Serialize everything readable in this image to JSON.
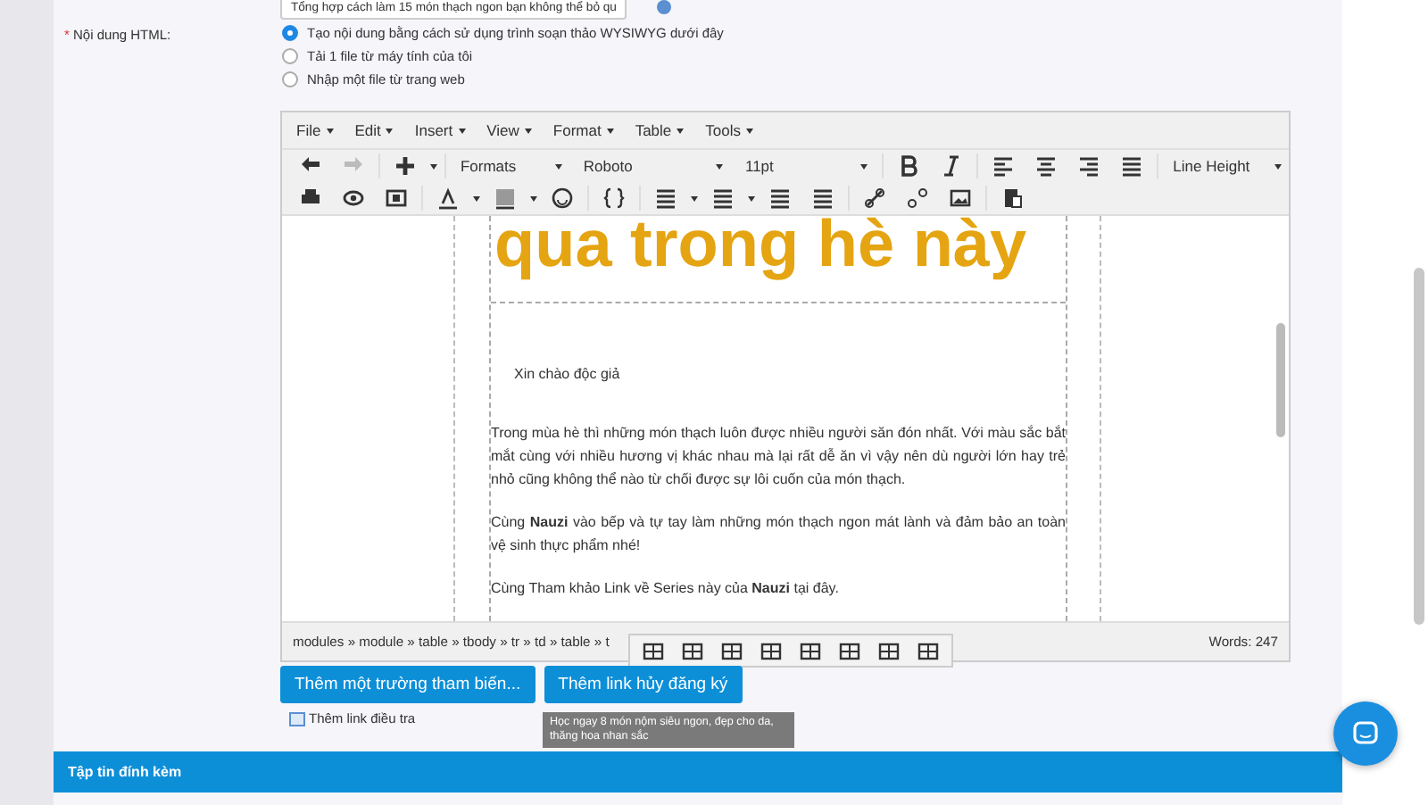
{
  "title_field": {
    "value": "Tổng hợp cách làm 15 món thạch ngon bạn không thể bỏ qu"
  },
  "html_content": {
    "label": "Nội dung HTML:",
    "required_mark": "*",
    "options": [
      {
        "label": "Tạo nội dung bằng cách sử dụng trình soạn thảo WYSIWYG dưới đây",
        "selected": true
      },
      {
        "label": "Tải 1 file từ máy tính của tôi",
        "selected": false
      },
      {
        "label": "Nhập một file từ trang web",
        "selected": false
      }
    ]
  },
  "editor": {
    "menus": [
      "File",
      "Edit",
      "Insert",
      "View",
      "Format",
      "Table",
      "Tools"
    ],
    "formats": "Formats",
    "font": "Roboto",
    "size": "11pt",
    "line_height": "Line Height",
    "heading": "qua trong hè này",
    "greeting": "Xin chào độc giả",
    "paragraphs": [
      "Trong mùa hè thì những món thạch luôn được nhiều người săn đón nhất. Với màu sắc bắt mắt cùng với nhiều hương vị khác nhau mà lại rất dễ ăn vì vậy nên dù người lớn hay trẻ nhỏ cũng không thể nào từ chối được sự lôi cuốn của món thạch.",
      "Cùng **Nauzi** vào bếp và tự tay làm những món thạch ngon mát lành và đảm bảo an toàn vệ sinh thực phẩm nhé!",
      "Cùng Tham khảo Link về Series này của **Nauzi** tại đây."
    ],
    "path": "modules » module » table » tbody » tr » td » table » t",
    "words": "Words: 247"
  },
  "buttons": [
    "Thêm một trường tham biến...",
    "Thêm link hủy đăng ký"
  ],
  "survey_link": "Thêm link điều tra",
  "tooltip": "Học ngay 8 món nộm siêu ngon, đẹp cho da, thăng hoa nhan sắc",
  "attachments": {
    "title": "Tập tin đính kèm"
  }
}
